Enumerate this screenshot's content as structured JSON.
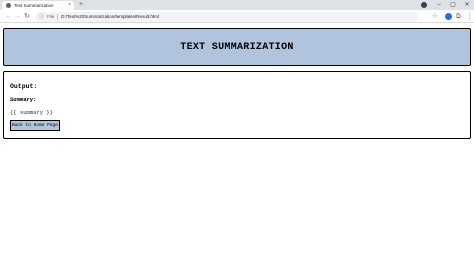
{
  "browser": {
    "tab_title": "Text Summarization",
    "tab_close": "×",
    "new_tab": "+",
    "omnibox": {
      "scheme": "File",
      "url": "D:/Text%20Summarization/templates/Result.html"
    },
    "window_controls": {
      "minimize": "–",
      "maximize": "▢",
      "close": "✕"
    },
    "nav": {
      "back": "←",
      "forward": "→",
      "reload": "↻"
    },
    "icons": {
      "info": "ⓘ",
      "star": "☆",
      "extensions": "⧉",
      "menu": "⋮",
      "media": "media-control-icon",
      "profile": "profile-avatar-icon",
      "tab_favicon": "globe-icon"
    }
  },
  "page": {
    "header_title": "TEXT SUMMARIZATION",
    "output_label": "Output:",
    "summary_label": "Summary:",
    "summary_value": "{{ summary }}",
    "back_button_label": "Back to Home Page"
  },
  "colors": {
    "header_bg": "#b0c4de",
    "button_bg": "#b0c4de",
    "border": "#000000",
    "tabstrip_bg": "#dee1e6"
  }
}
